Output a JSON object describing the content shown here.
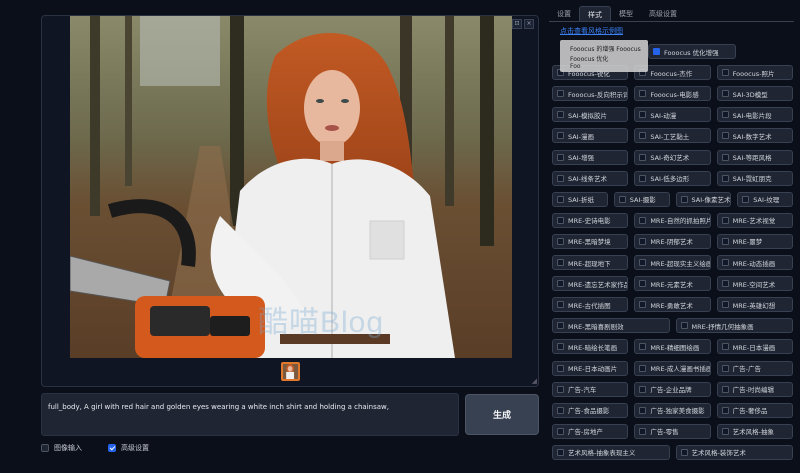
{
  "tabs": [
    "设置",
    "样式",
    "模型",
    "高级设置"
  ],
  "active_tab": "样式",
  "style_link": "点击查看风格示例图",
  "preview_popup": {
    "line1": "Fooocus 的增强 Fooocus",
    "line2": "Fooocus 优化",
    "line3": "Foo"
  },
  "prompt_text": "full_body,  A girl with red hair and golden eyes wearing a white inch shirt and holding a chainsaw,",
  "generate_label": "生成",
  "image_input_label": "图像输入",
  "advanced_label": "高级设置",
  "image_input_checked": false,
  "advanced_checked": true,
  "watermark": "酷喵Blog",
  "gallery_buttons": [
    "⊡",
    "×"
  ],
  "style_rows": [
    [
      {
        "label": "Fooocus 优化增强",
        "checked": true
      }
    ],
    [
      {
        "label": "Fooocus-锐化"
      },
      {
        "label": "Fooocus-杰作"
      },
      {
        "label": "Fooocus-照片"
      }
    ],
    [
      {
        "label": "Fooocus-反向积示词"
      },
      {
        "label": "Fooocus-电影感"
      },
      {
        "label": "SAI-3D模型"
      }
    ],
    [
      {
        "label": "SAI-模拟胶片"
      },
      {
        "label": "SAI-动漫"
      },
      {
        "label": "SAI-电影片段"
      }
    ],
    [
      {
        "label": "SAI-漫画"
      },
      {
        "label": "SAI-工艺黏土"
      },
      {
        "label": "SAI-数字艺术"
      }
    ],
    [
      {
        "label": "SAI-增强"
      },
      {
        "label": "SAI-奇幻艺术"
      },
      {
        "label": "SAI-等距风格"
      }
    ],
    [
      {
        "label": "SAI-线条艺术"
      },
      {
        "label": "SAI-低多边形"
      },
      {
        "label": "SAI-霓虹朋克"
      }
    ],
    [
      {
        "label": "SAI-折纸"
      },
      {
        "label": "SAI-摄影"
      },
      {
        "label": "SAI-像素艺术"
      },
      {
        "label": "SAI-纹理"
      }
    ],
    [
      {
        "label": "MRE-史诗电影"
      },
      {
        "label": "MRE-自然的抓拍照片"
      },
      {
        "label": "MRE-艺术视觉"
      }
    ],
    [
      {
        "label": "MRE-黑暗梦境"
      },
      {
        "label": "MRE-阴郁艺术"
      },
      {
        "label": "MRE-噩梦"
      }
    ],
    [
      {
        "label": "MRE-超现地下"
      },
      {
        "label": "MRE-超现实主义绘画"
      },
      {
        "label": "MRE-动态插画"
      }
    ],
    [
      {
        "label": "MRE-遗忘艺术家作品"
      },
      {
        "label": "MRE-元素艺术"
      },
      {
        "label": "MRE-空间艺术"
      }
    ],
    [
      {
        "label": "MRE-古代插图"
      },
      {
        "label": "MRE-勇敢艺术"
      },
      {
        "label": "MRE-英雄幻想"
      }
    ],
    [
      {
        "label": "MRE-黑暗喜剧剧效"
      },
      {
        "label": "MRE-抒情几何抽象画"
      }
    ],
    [
      {
        "label": "MRE-暗绘长笔画"
      },
      {
        "label": "MRE-精细图绘画"
      },
      {
        "label": "MRE-日本漫画"
      }
    ],
    [
      {
        "label": "MRE-日本动画片"
      },
      {
        "label": "MRE-成人漫画书插画"
      },
      {
        "label": "广告-广告"
      }
    ],
    [
      {
        "label": "广告-汽车"
      },
      {
        "label": "广告-企业品牌"
      },
      {
        "label": "广告-时尚编辑"
      }
    ],
    [
      {
        "label": "广告-食品摄影"
      },
      {
        "label": "广告-独家美食摄影"
      },
      {
        "label": "广告-奢侈品"
      }
    ],
    [
      {
        "label": "广告-房地产"
      },
      {
        "label": "广告-零售"
      },
      {
        "label": "艺术风格-抽象"
      }
    ],
    [
      {
        "label": "艺术风格-抽象表现主义"
      },
      {
        "label": "艺术风格-装饰艺术"
      }
    ]
  ]
}
